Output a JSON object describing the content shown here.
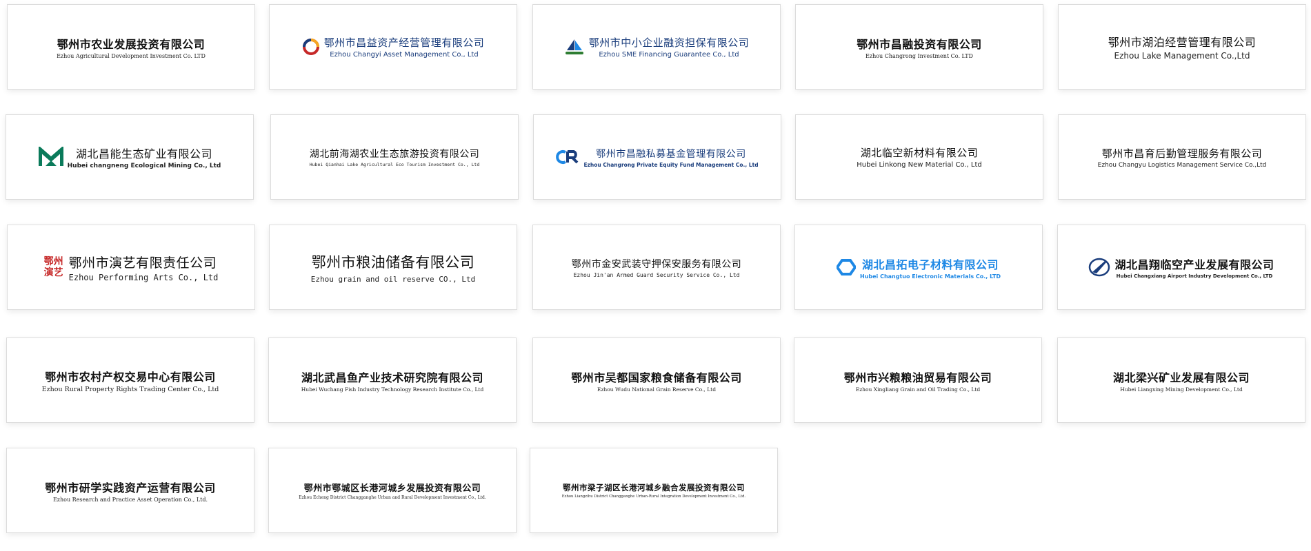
{
  "logos": [
    {
      "zh": "鄂州市农业发展投资有限公司",
      "en": "Ezhou Agricultural Development Investment Co. LTD"
    },
    {
      "zh": "鄂州市昌益资产经营管理有限公司",
      "en": "Ezhou Changyi Asset Management Co., Ltd"
    },
    {
      "zh": "鄂州市中小企业融资担保有限公司",
      "en": "Ezhou SME Financing Guarantee Co., Ltd"
    },
    {
      "zh": "鄂州市昌融投资有限公司",
      "en": "Ezhou Changrong Investment Co. LTD"
    },
    {
      "zh": "鄂州市湖泊经营管理有限公司",
      "en": "Ezhou Lake Management Co.,Ltd"
    },
    {
      "zh": "湖北昌能生态矿业有限公司",
      "en": "Hubei changneng Ecological Mining Co., Ltd"
    },
    {
      "zh": "湖北前海湖农业生态旅游投资有限公司",
      "en": "Hubei Qianhai Lake Agricultural Eco Tourism Investment Co., Ltd"
    },
    {
      "zh": "鄂州市昌融私募基金管理有限公司",
      "en": "Ezhou Changrong Private Equity Fund Management Co., Ltd"
    },
    {
      "zh": "湖北临空新材料有限公司",
      "en": "Hubei Linkong New Material Co., Ltd"
    },
    {
      "zh": "鄂州市昌育后勤管理服务有限公司",
      "en": "Ezhou Changyu Logistics Management Service Co.,Ltd"
    },
    {
      "zh": "鄂州市演艺有限责任公司",
      "en": "Ezhou Performing Arts Co., Ltd",
      "seal": "鄂州演艺"
    },
    {
      "zh": "鄂州市粮油储备有限公司",
      "en": "Ezhou grain and oil reserve CO., Ltd"
    },
    {
      "zh": "鄂州市金安武装守押保安服务有限公司",
      "en": "Ezhou Jin'an Armed Guard Security Service Co., Ltd"
    },
    {
      "zh": "湖北昌拓电子材料有限公司",
      "en": "Hubei Changtuo Electronic Materials Co., LTD"
    },
    {
      "zh": "湖北昌翔临空产业发展有限公司",
      "en": "Hubei Changxiang Airport Industry Development Co., LTD"
    },
    {
      "zh": "鄂州市农村产权交易中心有限公司",
      "en": "Ezhou Rural Property Rights Trading Center Co., Ltd"
    },
    {
      "zh": "湖北武昌鱼产业技术研究院有限公司",
      "en": "Hubei Wuchang Fish Industry Technology Research Institute Co., Ltd"
    },
    {
      "zh": "鄂州市吴都国家粮食储备有限公司",
      "en": "Ezhou Wudu National Grain Reserve Co., Ltd"
    },
    {
      "zh": "鄂州市兴粮粮油贸易有限公司",
      "en": "Ezhou Xingliang Grain and Oil Trading Co., Ltd"
    },
    {
      "zh": "湖北梁兴矿业发展有限公司",
      "en": "Hubei Liangxing Mining Development Co., Ltd"
    },
    {
      "zh": "鄂州市研学实践资产运营有限公司",
      "en": "Ezhou Research and Practice Asset Operation Co., Ltd."
    },
    {
      "zh": "鄂州市鄂城区长港河城乡发展投资有限公司",
      "en": "Ezhou Echeng District Changganghe Urban and Rural Development Investment Co., Ltd."
    },
    {
      "zh": "鄂州市梁子湖区长港河城乡融合发展投资有限公司",
      "en": "Ezhou Liangzihu District Changganghe Urban-Rural Integration Development Investment Co., Ltd."
    }
  ],
  "colors": {
    "blue": "#1e88e5",
    "green": "#0a7a5a",
    "red": "#c62828",
    "navy": "#1a3d7c"
  }
}
